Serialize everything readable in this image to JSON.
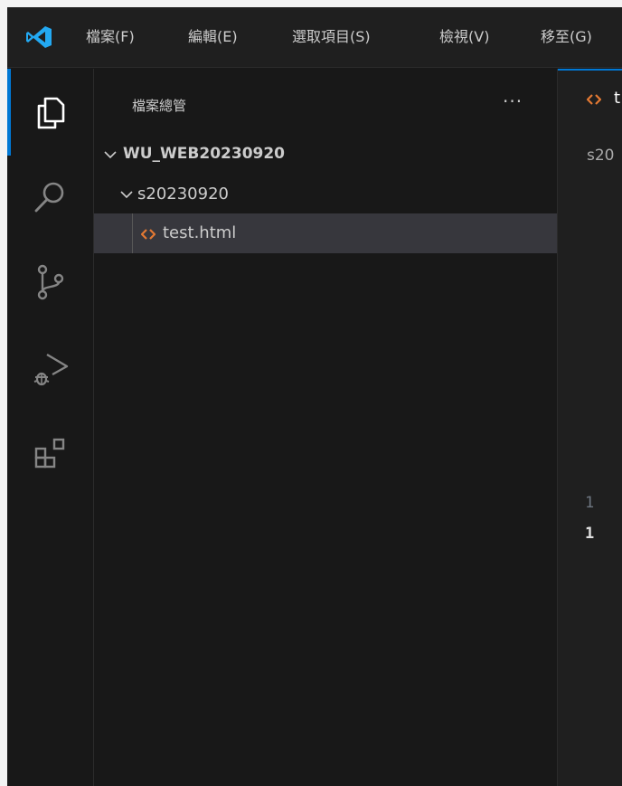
{
  "menu": {
    "items": [
      {
        "label": "檔案(F)"
      },
      {
        "label": "編輯(E)"
      },
      {
        "label": "選取項目(S)"
      },
      {
        "label": "檢視(V)"
      },
      {
        "label": "移至(G)"
      }
    ]
  },
  "activity_bar": {
    "items": [
      {
        "icon": "explorer-icon",
        "active": true
      },
      {
        "icon": "search-icon",
        "active": false
      },
      {
        "icon": "source-control-icon",
        "active": false
      },
      {
        "icon": "run-debug-icon",
        "active": false
      },
      {
        "icon": "extensions-icon",
        "active": false
      }
    ]
  },
  "sidebar": {
    "title": "檔案總管",
    "more_label": "···",
    "tree": [
      {
        "label": "WU_WEB20230920",
        "type": "folder",
        "expanded": true
      },
      {
        "label": "s20230920",
        "type": "folder",
        "expanded": true
      },
      {
        "label": "test.html",
        "type": "file",
        "selected": true
      }
    ]
  },
  "editor": {
    "tab_label": "t",
    "breadcrumb": "s20",
    "line_numbers": [
      "1",
      "1"
    ]
  },
  "colors": {
    "accent": "#0078d4",
    "html_icon": "#e37933",
    "logo": "#23a9f2",
    "selection": "#37373d"
  }
}
